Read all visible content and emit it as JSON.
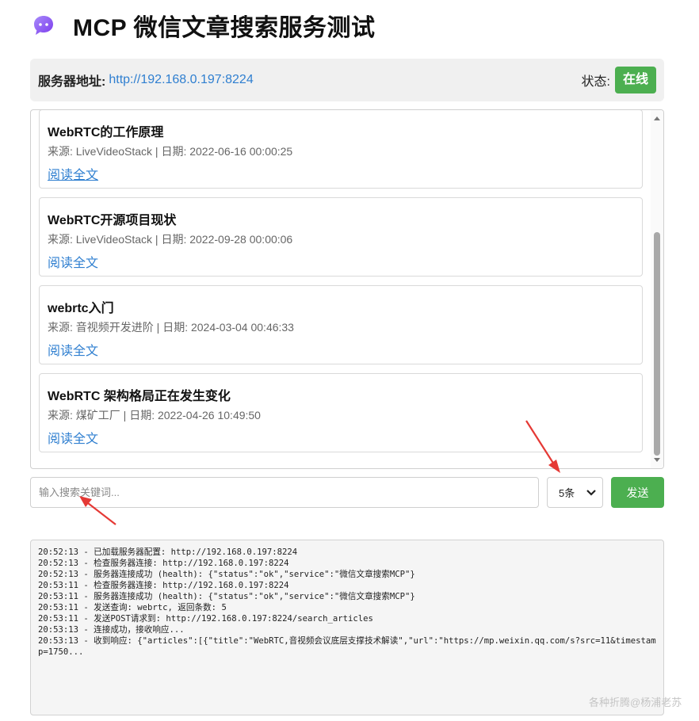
{
  "header": {
    "title": "MCP 微信文章搜索服务测试",
    "logo_icon": "chat-bubble-icon",
    "logo_color": "#8b5cf6"
  },
  "server": {
    "label": "服务器地址:",
    "url": "http://192.168.0.197:8224",
    "status_label": "状态:",
    "status_value": "在线",
    "status_color": "#4caf50"
  },
  "results": [
    {
      "title": "WebRTC的工作原理",
      "meta": "来源: LiveVideoStack | 日期: 2022-06-16 00:00:25",
      "link": "阅读全文",
      "visited": true
    },
    {
      "title": "WebRTC开源项目现状",
      "meta": "来源: LiveVideoStack | 日期: 2022-09-28 00:00:06",
      "link": "阅读全文",
      "visited": false
    },
    {
      "title": "webrtc入门",
      "meta": "来源: 音视频开发进阶 | 日期: 2024-03-04 00:46:33",
      "link": "阅读全文",
      "visited": false
    },
    {
      "title": "WebRTC 架构格局正在发生变化",
      "meta": "来源: 煤矿工厂 | 日期: 2022-04-26 10:49:50",
      "link": "阅读全文",
      "visited": false
    }
  ],
  "search": {
    "placeholder": "输入搜索关键词...",
    "value": "",
    "count_selected": "5条",
    "send_label": "发送"
  },
  "log": [
    "20:52:13 - 已加载服务器配置: http://192.168.0.197:8224",
    "20:52:13 - 检查服务器连接: http://192.168.0.197:8224",
    "20:52:13 - 服务器连接成功 (health): {\"status\":\"ok\",\"service\":\"微信文章搜索MCP\"}",
    "20:53:11 - 检查服务器连接: http://192.168.0.197:8224",
    "20:53:11 - 服务器连接成功 (health): {\"status\":\"ok\",\"service\":\"微信文章搜索MCP\"}",
    "20:53:11 - 发送查询: webrtc, 返回条数: 5",
    "20:53:11 - 发送POST请求到: http://192.168.0.197:8224/search_articles",
    "20:53:13 - 连接成功，接收响应...",
    "20:53:13 - 收到响应: {\"articles\":[{\"title\":\"WebRTC,音视频会议底层支撑技术解读\",\"url\":\"https://mp.weixin.qq.com/s?src=11&timestamp=1750..."
  ],
  "watermark": "各种折腾@杨浦老苏",
  "annotation_color": "#e53935"
}
